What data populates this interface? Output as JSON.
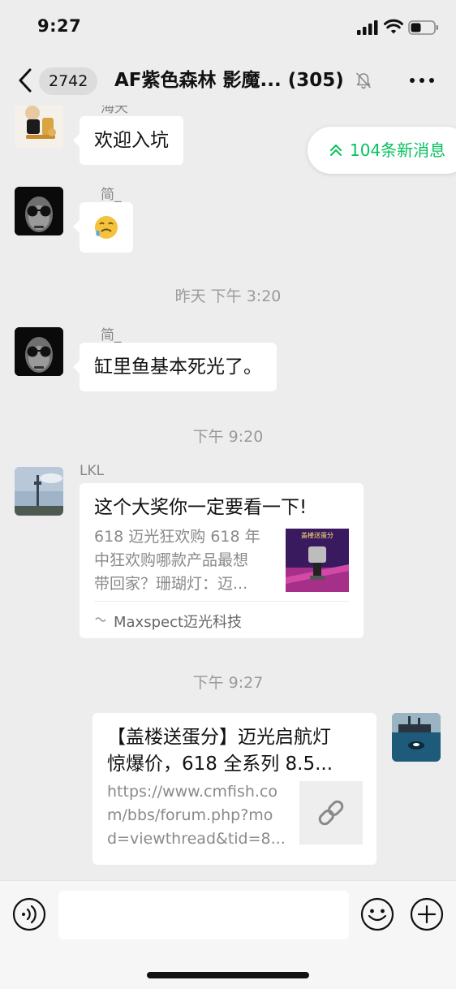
{
  "status_bar": {
    "time": "9:27"
  },
  "nav": {
    "back_icon": "chevron-left-icon",
    "unread_badge": "2742",
    "title": "AF紫色森林 影魔... (305)",
    "muted_icon": "bell-slash-icon",
    "more_icon": "ellipsis-icon"
  },
  "new_messages": {
    "label": "104条新消息",
    "icon": "double-chevron-up-icon",
    "color": "#07c160"
  },
  "messages": [
    {
      "sender": "海天",
      "text": "欢迎入坑"
    },
    {
      "sender": "简_",
      "text": "😓"
    },
    {
      "sender": "简_",
      "text": "缸里鱼基本死光了。"
    },
    {
      "sender": "LKL",
      "card": {
        "title": "这个大奖你一定要看一下!",
        "desc_lines": [
          "618 迈光狂欢购 618 年",
          "中狂欢购哪款产品最想",
          "带回家？珊瑚灯：迈..."
        ],
        "thumb_text": "盖楼送蛋分",
        "source": "Maxspect迈光科技"
      }
    },
    {
      "sender": "",
      "card": {
        "title_lines": [
          "【盖楼送蛋分】迈光启航灯",
          "惊爆价，618 全系列 8.5..."
        ],
        "desc_lines": [
          "https://www.cmfish.co",
          "m/bbs/forum.php?mo",
          "d=viewthread&tid=8..."
        ],
        "thumb_icon": "link-icon"
      }
    }
  ],
  "timestamps": [
    "昨天 下午 3:20",
    "下午 9:20",
    "下午 9:27"
  ],
  "input_bar": {
    "voice_icon": "voice-icon",
    "emoji_icon": "emoji-icon",
    "plus_icon": "plus-circle-icon",
    "input_value": ""
  }
}
